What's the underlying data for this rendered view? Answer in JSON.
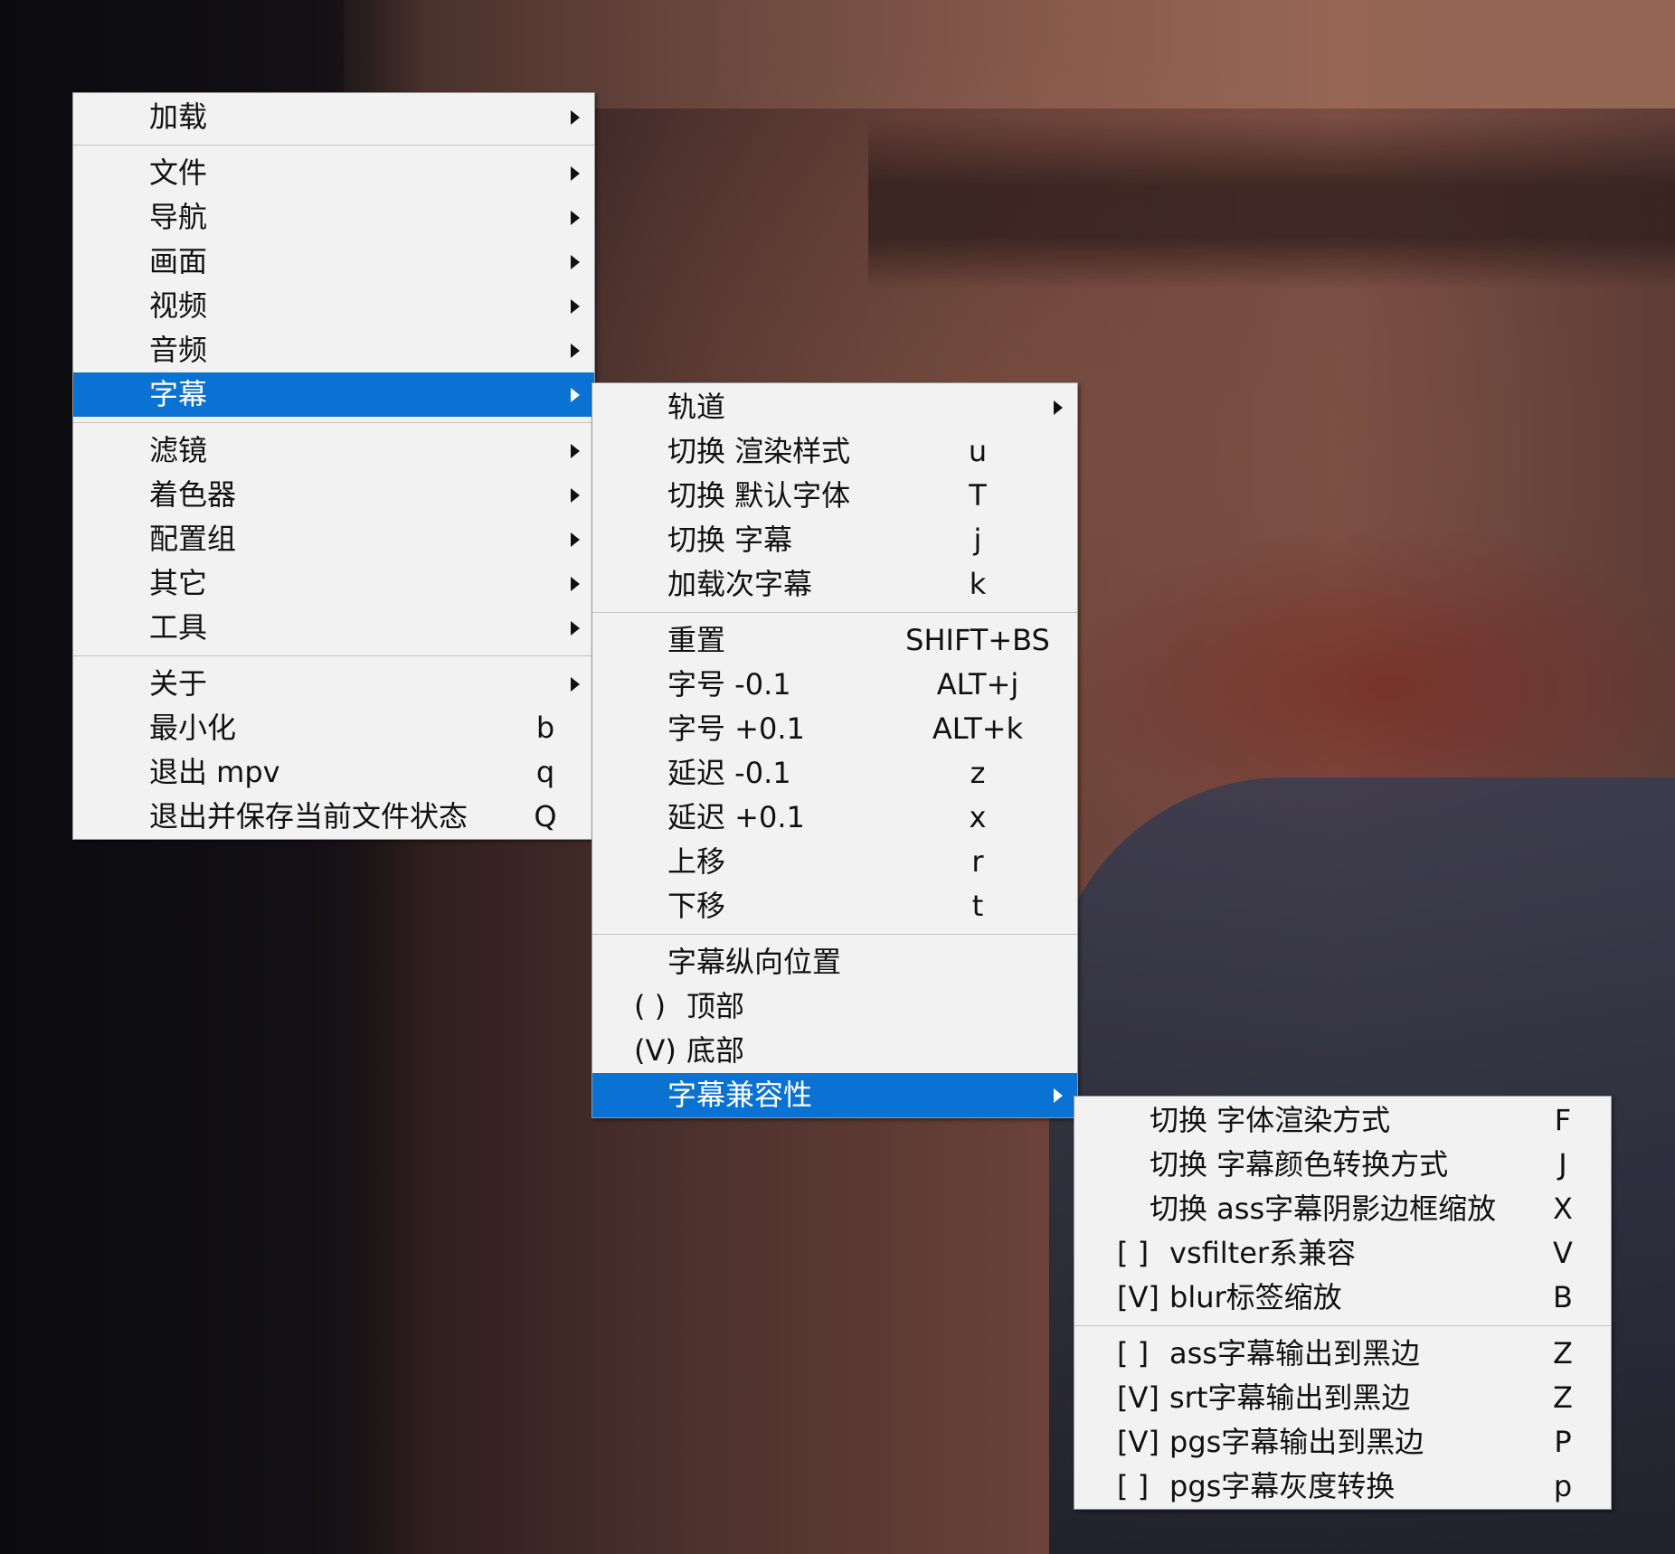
{
  "menu_main": {
    "groups": [
      [
        {
          "label": "加载",
          "submenu": true
        }
      ],
      [
        {
          "label": "文件",
          "submenu": true
        },
        {
          "label": "导航",
          "submenu": true
        },
        {
          "label": "画面",
          "submenu": true
        },
        {
          "label": "视频",
          "submenu": true
        },
        {
          "label": "音频",
          "submenu": true
        },
        {
          "label": "字幕",
          "submenu": true,
          "selected": true
        }
      ],
      [
        {
          "label": "滤镜",
          "submenu": true
        },
        {
          "label": "着色器",
          "submenu": true
        },
        {
          "label": "配置组",
          "submenu": true
        },
        {
          "label": "其它",
          "submenu": true
        },
        {
          "label": "工具",
          "submenu": true
        }
      ],
      [
        {
          "label": "关于",
          "submenu": true
        },
        {
          "label": "最小化",
          "shortcut": "b"
        },
        {
          "label": "退出 mpv",
          "shortcut": "q"
        },
        {
          "label": "退出并保存当前文件状态",
          "shortcut": "Q"
        }
      ]
    ]
  },
  "menu_subtitle": {
    "groups": [
      [
        {
          "label": "轨道",
          "submenu": true
        },
        {
          "label": "切换 渲染样式",
          "shortcut": "u"
        },
        {
          "label": "切换 默认字体",
          "shortcut": "T"
        },
        {
          "label": "切换 字幕",
          "shortcut": "j"
        },
        {
          "label": "加载次字幕",
          "shortcut": "k"
        }
      ],
      [
        {
          "label": "重置",
          "shortcut": "SHIFT+BS"
        },
        {
          "label": "字号 -0.1",
          "shortcut": "ALT+j"
        },
        {
          "label": "字号 +0.1",
          "shortcut": "ALT+k"
        },
        {
          "label": "延迟 -0.1",
          "shortcut": "z"
        },
        {
          "label": "延迟 +0.1",
          "shortcut": "x"
        },
        {
          "label": "上移",
          "shortcut": "r"
        },
        {
          "label": "下移",
          "shortcut": "t"
        }
      ],
      [
        {
          "label": "字幕纵向位置"
        },
        {
          "prefix": "( )",
          "label": "顶部"
        },
        {
          "prefix": "(V)",
          "label": "底部"
        },
        {
          "label": "字幕兼容性",
          "submenu": true,
          "selected": true
        }
      ]
    ]
  },
  "menu_compat": {
    "groups": [
      [
        {
          "label": "切换 字体渲染方式",
          "shortcut": "F"
        },
        {
          "label": "切换 字幕颜色转换方式",
          "shortcut": "J"
        },
        {
          "label": "切换 ass字幕阴影边框缩放",
          "shortcut": "X"
        },
        {
          "prefix": "[ ]",
          "label": "vsfilter系兼容",
          "shortcut": "V"
        },
        {
          "prefix": "[V]",
          "label": "blur标签缩放",
          "shortcut": "B"
        }
      ],
      [
        {
          "prefix": "[ ]",
          "label": "ass字幕输出到黑边",
          "shortcut": "Z"
        },
        {
          "prefix": "[V]",
          "label": "srt字幕输出到黑边",
          "shortcut": "Z"
        },
        {
          "prefix": "[V]",
          "label": "pgs字幕输出到黑边",
          "shortcut": "P"
        },
        {
          "prefix": "[ ]",
          "label": "pgs字幕灰度转换",
          "shortcut": "p"
        }
      ]
    ]
  },
  "colors": {
    "menu_bg": "#f2f2f2",
    "selection_bg": "#0a72d2",
    "separator": "#c4c4c4",
    "text": "#111111"
  }
}
